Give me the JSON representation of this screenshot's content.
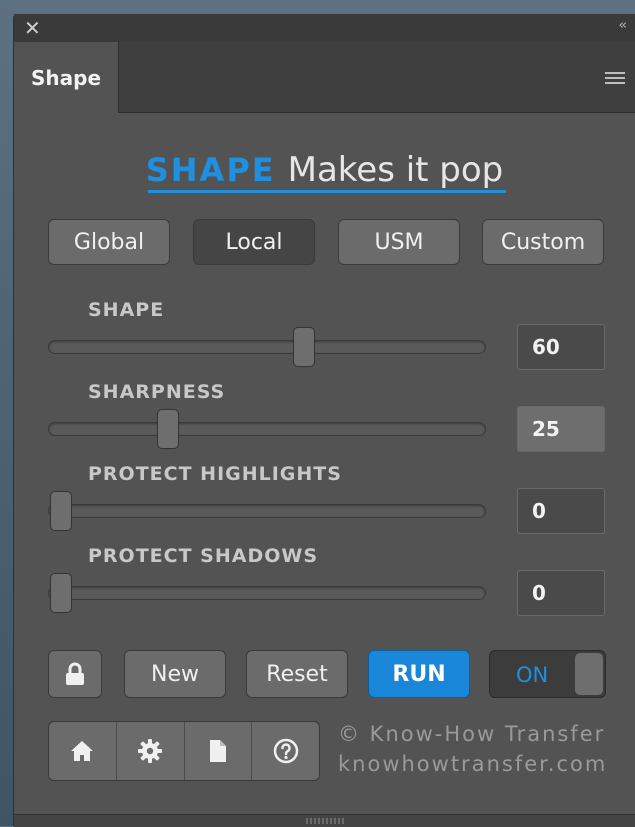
{
  "titlebar": {
    "close": "✕",
    "collapse": "‹‹"
  },
  "tab": {
    "label": "Shape"
  },
  "header": {
    "brand": "SHAPE",
    "tagline": "Makes it pop"
  },
  "modes": [
    {
      "label": "Global",
      "active": false
    },
    {
      "label": "Local",
      "active": true
    },
    {
      "label": "USM",
      "active": false
    },
    {
      "label": "Custom",
      "active": false
    }
  ],
  "sliders": [
    {
      "label": "SHAPE",
      "value": "60",
      "level": 0.59
    },
    {
      "label": "SHARPNESS",
      "value": "25",
      "level": 0.26
    },
    {
      "label": "PROTECT HIGHLIGHTS",
      "value": "0",
      "level": 0.0
    },
    {
      "label": "PROTECT SHADOWS",
      "value": "0",
      "level": 0.0
    }
  ],
  "actions": {
    "new": "New",
    "reset": "Reset",
    "run": "RUN",
    "toggle": "ON"
  },
  "footer": {
    "credit": "©  Know-How Transfer",
    "url": "knowhowtransfer.com"
  },
  "colors": {
    "accent": "#1f8fe0",
    "panel": "#535353"
  },
  "icons": [
    "lock-icon",
    "home-icon",
    "gear-icon",
    "document-icon",
    "help-icon",
    "menu-icon",
    "close-icon"
  ]
}
